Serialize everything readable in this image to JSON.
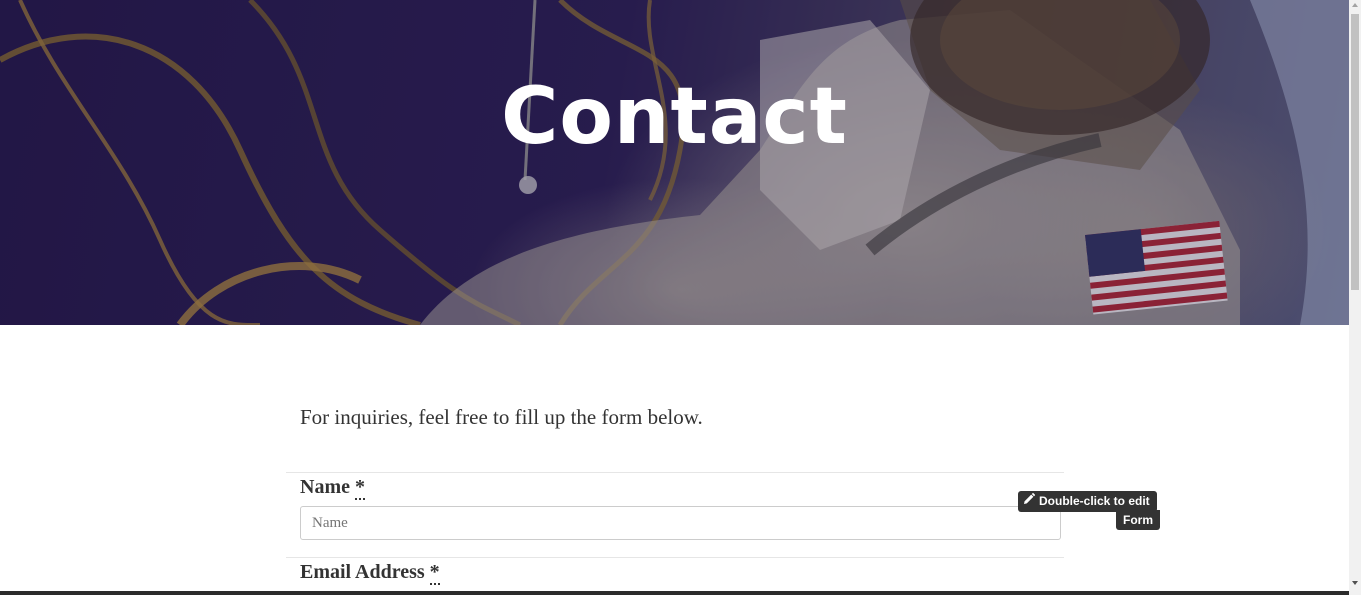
{
  "hero": {
    "title": "Contact"
  },
  "intro": {
    "text": "For inquiries, feel free to fill up the form below."
  },
  "form": {
    "fields": [
      {
        "label": "Name",
        "required_mark": "*",
        "placeholder": "Name"
      },
      {
        "label": "Email Address",
        "required_mark": "*"
      }
    ]
  },
  "editor": {
    "edit_hint": "Double-click to edit",
    "block_name": "Form",
    "edit_icon": "pencil-icon"
  },
  "colors": {
    "hero_overlay": "#231848",
    "tooltip_bg": "#333333",
    "text": "#333333"
  }
}
